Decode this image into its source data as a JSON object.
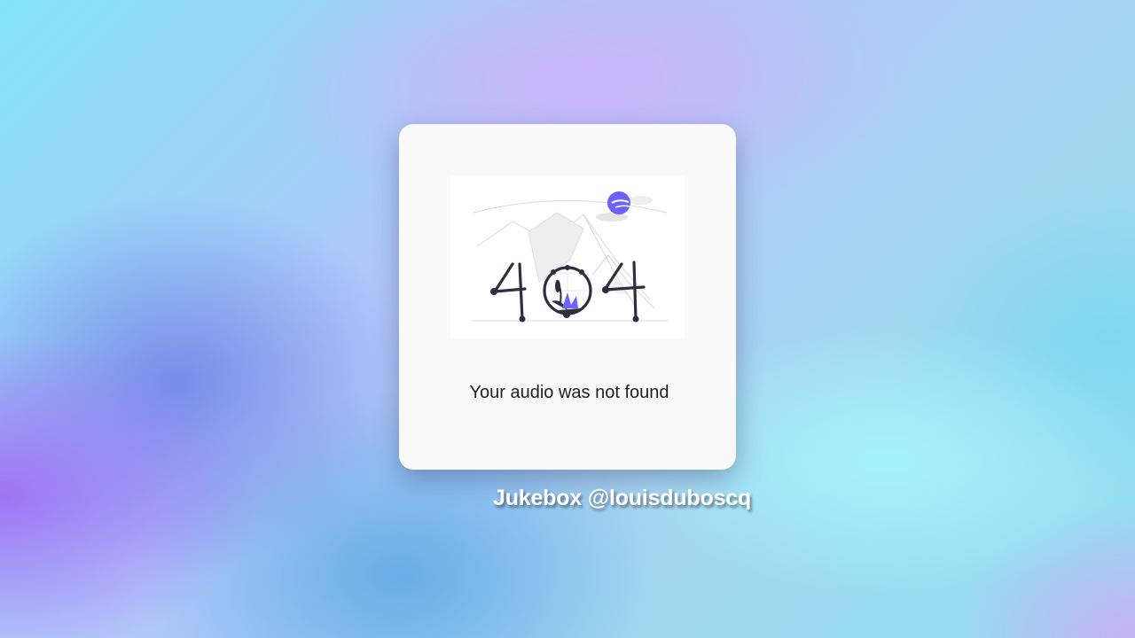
{
  "card": {
    "illustration": {
      "icon": "404-illustration",
      "accent_color": "#6c63ff",
      "ink_color": "#2f2e41"
    },
    "message": "Your audio was not found"
  },
  "footer": {
    "credit": "Jukebox @louisduboscq"
  }
}
